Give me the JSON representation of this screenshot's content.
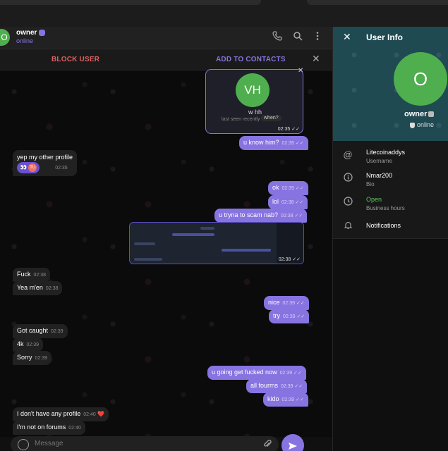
{
  "chat": {
    "name": "owner",
    "status": "online",
    "avatar_letter": "O",
    "icons": [
      "phone-icon",
      "search-icon",
      "more-icon"
    ],
    "block_label": "BLOCK USER",
    "add_label": "ADD TO CONTACTS"
  },
  "contact_card": {
    "initials": "VH",
    "name": "w hh",
    "last_seen": "last seen recently",
    "when": "when?",
    "time": "02:35"
  },
  "messages": [
    {
      "id": "m1",
      "dir": "out",
      "text": "u know him?",
      "time": "02:35"
    },
    {
      "id": "m2",
      "dir": "in",
      "text": "yep my other profile",
      "time": "02:35",
      "reaction": "TU"
    },
    {
      "id": "m3",
      "dir": "out",
      "text": "ok",
      "time": "02:35"
    },
    {
      "id": "m4",
      "dir": "out",
      "text": "lol",
      "time": "02:38"
    },
    {
      "id": "m5",
      "dir": "out",
      "text": "u tryna to scam nab?",
      "time": "02:38"
    },
    {
      "id": "m6",
      "dir": "out",
      "text": "",
      "time": "02:38"
    },
    {
      "id": "m7",
      "dir": "in",
      "text": "Fuck",
      "time": "02:38"
    },
    {
      "id": "m8",
      "dir": "in",
      "text": "Yea m'en",
      "time": "02:38"
    },
    {
      "id": "m9",
      "dir": "out",
      "text": "nice",
      "time": "02:39"
    },
    {
      "id": "m10",
      "dir": "out",
      "text": "try",
      "time": "02:39"
    },
    {
      "id": "m11",
      "dir": "in",
      "text": "Got caught",
      "time": "02:39"
    },
    {
      "id": "m12",
      "dir": "in",
      "text": "4k",
      "time": "02:39"
    },
    {
      "id": "m13",
      "dir": "in",
      "text": "Sorry",
      "time": "02:39"
    },
    {
      "id": "m14",
      "dir": "out",
      "text": "u going get fucked now",
      "time": "02:39"
    },
    {
      "id": "m15",
      "dir": "out",
      "text": "all fourms",
      "time": "02:39"
    },
    {
      "id": "m16",
      "dir": "out",
      "text": "kido",
      "time": "02:39"
    },
    {
      "id": "m17",
      "dir": "in",
      "text": "I don't have any profile",
      "time": "02:40",
      "heart": "❤️"
    },
    {
      "id": "m18",
      "dir": "in",
      "text": "I'm not on forums",
      "time": "02:40"
    }
  ],
  "composer": {
    "placeholder": "Message"
  },
  "panel": {
    "title": "User Info",
    "avatar_letter": "O",
    "name": "owner",
    "status": "online",
    "username": "Litecoinaddys",
    "username_label": "Username",
    "bio": "Nmar200",
    "bio_label": "Bio",
    "hours": "Open",
    "hours_label": "Business hours",
    "notifications_label": "Notifications"
  },
  "colors": {
    "accent": "#8774e1",
    "avatar_green": "#4fae4e",
    "danger": "#e06060",
    "open_green": "#5fc85f"
  }
}
